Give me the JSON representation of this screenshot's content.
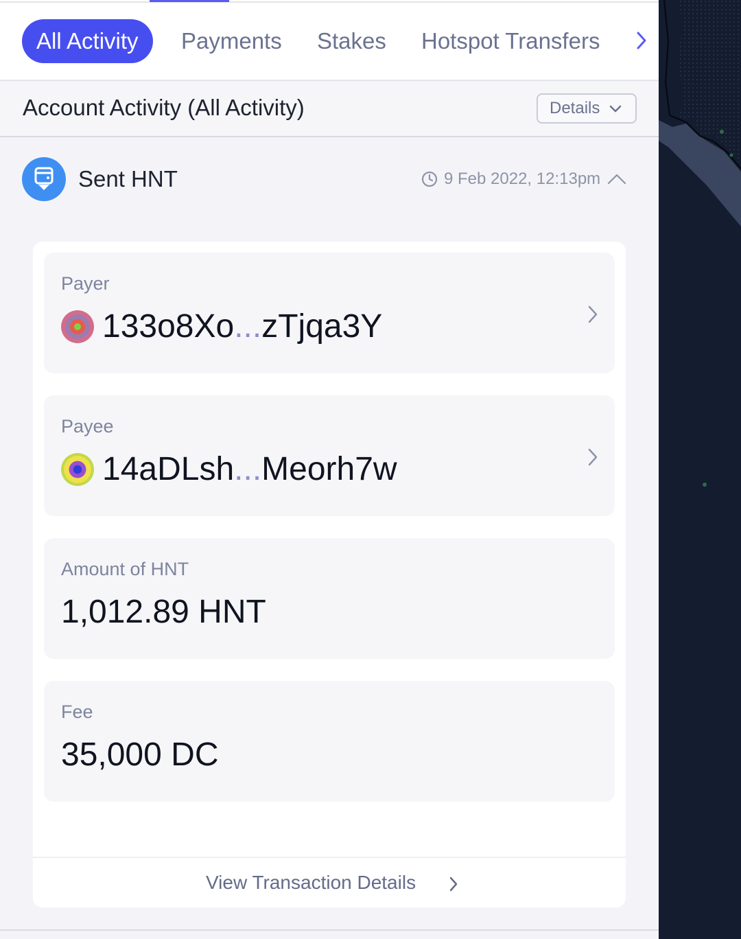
{
  "tabs": {
    "items": [
      {
        "label": "All Activity",
        "active": true
      },
      {
        "label": "Payments",
        "active": false
      },
      {
        "label": "Stakes",
        "active": false
      },
      {
        "label": "Hotspot Transfers",
        "active": false
      }
    ],
    "scroll_icon": "chevron-right-icon"
  },
  "header": {
    "title": "Account Activity (All Activity)",
    "details_label": "Details",
    "details_icon": "chevron-down-icon"
  },
  "transaction": {
    "title": "Sent HNT",
    "icon": "wallet-send-icon",
    "timestamp": "9 Feb 2022, 12:13pm",
    "clock_icon": "clock-icon",
    "collapse_icon": "chevron-up-icon"
  },
  "details": {
    "payer": {
      "label": "Payer",
      "address_start": "133o8Xo",
      "ellipsis": "...",
      "address_end": "zTjqa3Y"
    },
    "payee": {
      "label": "Payee",
      "address_start": "14aDLsh",
      "ellipsis": "...",
      "address_end": "Meorh7w"
    },
    "amount": {
      "label": "Amount of HNT",
      "value": "1,012.89 HNT"
    },
    "fee": {
      "label": "Fee",
      "value": "35,000 DC"
    },
    "view_label": "View Transaction Details"
  },
  "colors": {
    "accent": "#474ef0",
    "icon_blue": "#3f8ff3",
    "muted_text": "#7d849d",
    "map_background": "#141c2f"
  }
}
